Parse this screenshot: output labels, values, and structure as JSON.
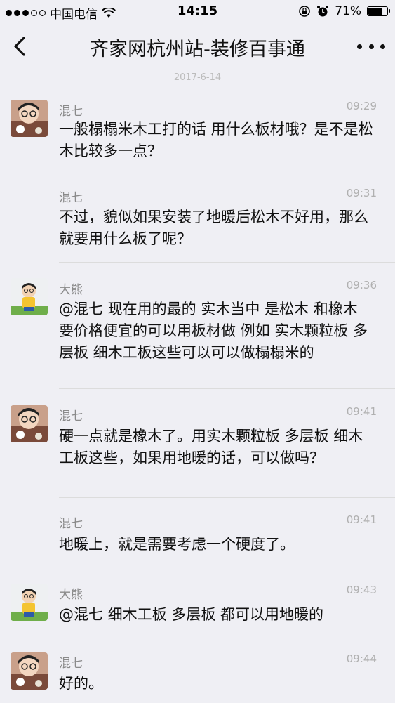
{
  "status_bar": {
    "carrier": "中国电信",
    "time": "14:15",
    "battery": "71%",
    "battery_level": 0.71
  },
  "nav": {
    "title": "齐家网杭州站-装修百事通"
  },
  "date_divider": "2017-6-14",
  "messages": [
    {
      "sender": "混七",
      "time": "09:29",
      "text": "一般榻榻米木工打的话 用什么板材哦？是不是松木比较多一点？",
      "avatar": "avatar-hunqi"
    },
    {
      "sender": "混七",
      "time": "09:31",
      "text": "不过，貌似如果安装了地暖后松木不好用，那么就要用什么板了呢？",
      "avatar": null
    },
    {
      "sender": "大熊",
      "time": "09:36",
      "text": "@混七 现在用的最的 实木当中 是松木 和橡木　要价格便宜的可以用板材做 例如 实木颗粒板 多层板 细木工板这些可以可以做榻榻米的",
      "avatar": "avatar-daxiong"
    },
    {
      "sender": "混七",
      "time": "09:41",
      "text": "硬一点就是橡木了。用实木颗粒板 多层板 细木工板这些，如果用地暖的话，可以做吗？",
      "avatar": "avatar-hunqi"
    },
    {
      "sender": "混七",
      "time": "09:41",
      "text": "地暖上，就是需要考虑一个硬度了。",
      "avatar": null
    },
    {
      "sender": "大熊",
      "time": "09:43",
      "text": "@混七 细木工板 多层板 都可以用地暖的",
      "avatar": "avatar-daxiong"
    },
    {
      "sender": "混七",
      "time": "09:44",
      "text": "好的。",
      "avatar": "avatar-hunqi"
    }
  ]
}
